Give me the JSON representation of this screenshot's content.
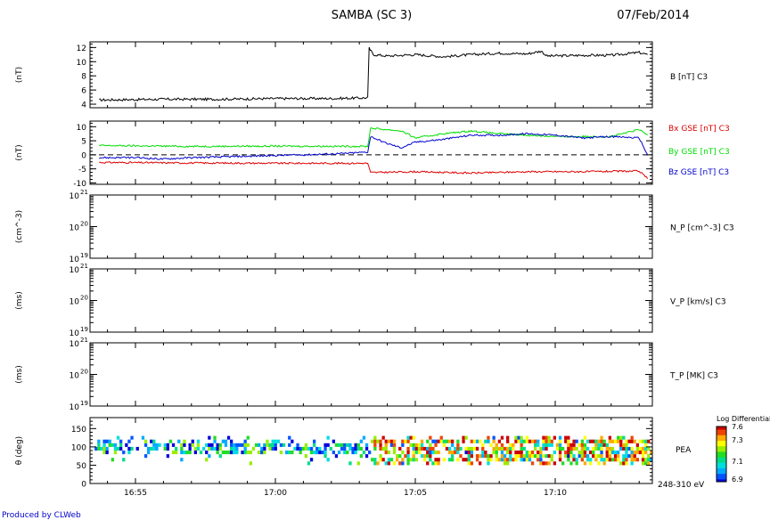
{
  "header": {
    "title": "SAMBA (SC 3)",
    "date": "07/Feb/2014"
  },
  "footer": {
    "credit": "Produced by CLWeb"
  },
  "colors": {
    "black": "#000000",
    "red": "#dd0000",
    "green": "#00dd00",
    "blue": "#0000cc"
  },
  "time_ticks": [
    "16:55",
    "17:00",
    "17:05",
    "17:10"
  ],
  "chart_data": [
    {
      "type": "line",
      "ylabel": "(nT)",
      "ylim": [
        3.5,
        12.8
      ],
      "yticks": [
        4,
        6,
        8,
        10,
        12
      ],
      "xlim_min": [
        -6.4,
        13.3
      ],
      "series": [
        {
          "name": "B [nT] C3",
          "color": "#000000",
          "points": [
            [
              -6.3,
              4.6
            ],
            [
              -4,
              4.7
            ],
            [
              -2,
              4.7
            ],
            [
              0,
              4.8
            ],
            [
              2,
              4.8
            ],
            [
              3.3,
              4.9
            ],
            [
              3.35,
              11.9
            ],
            [
              3.5,
              11.0
            ],
            [
              4,
              10.8
            ],
            [
              5,
              11.0
            ],
            [
              6,
              10.7
            ],
            [
              7,
              11.0
            ],
            [
              8,
              11.2
            ],
            [
              9,
              11.1
            ],
            [
              9.5,
              11.5
            ],
            [
              9.7,
              10.8
            ],
            [
              11,
              10.9
            ],
            [
              12,
              10.9
            ],
            [
              13,
              11.3
            ],
            [
              13.3,
              11.0
            ]
          ]
        }
      ]
    },
    {
      "type": "line",
      "ylabel": "(nT)",
      "ylim": [
        -10.5,
        12
      ],
      "yticks": [
        -10,
        -5,
        0,
        5,
        10
      ],
      "zero_line": true,
      "xlim_min": [
        -6.4,
        13.3
      ],
      "series": [
        {
          "name": "Bx GSE [nT] C3",
          "color": "#dd0000",
          "points": [
            [
              -6.3,
              -2.7
            ],
            [
              -3,
              -2.9
            ],
            [
              0,
              -3.0
            ],
            [
              3.3,
              -3.0
            ],
            [
              3.4,
              -6.3
            ],
            [
              5,
              -6.0
            ],
            [
              7,
              -6.5
            ],
            [
              9,
              -6.0
            ],
            [
              11,
              -6.0
            ],
            [
              13,
              -5.8
            ],
            [
              13.3,
              -8.5
            ]
          ]
        },
        {
          "name": "By GSE [nT] C3",
          "color": "#00dd00",
          "points": [
            [
              -6.3,
              3.3
            ],
            [
              -3,
              3.0
            ],
            [
              0,
              3.1
            ],
            [
              3.3,
              3.0
            ],
            [
              3.4,
              9.5
            ],
            [
              4.5,
              8.5
            ],
            [
              5,
              6.0
            ],
            [
              6,
              7.5
            ],
            [
              7,
              8.5
            ],
            [
              8,
              7.5
            ],
            [
              9,
              7.0
            ],
            [
              10,
              6.5
            ],
            [
              12,
              6.5
            ],
            [
              13,
              9.0
            ],
            [
              13.3,
              7.0
            ]
          ]
        },
        {
          "name": "Bz GSE [nT] C3",
          "color": "#0000cc",
          "points": [
            [
              -6.3,
              -1.0
            ],
            [
              -5,
              -1.0
            ],
            [
              -4,
              -1.5
            ],
            [
              -3,
              -1.0
            ],
            [
              -1,
              -0.5
            ],
            [
              1,
              0.0
            ],
            [
              2.5,
              0.5
            ],
            [
              3.3,
              1.0
            ],
            [
              3.4,
              6.5
            ],
            [
              4,
              4.0
            ],
            [
              4.5,
              2.5
            ],
            [
              5,
              4.5
            ],
            [
              6,
              5.5
            ],
            [
              7,
              7.0
            ],
            [
              8,
              7.0
            ],
            [
              9,
              7.5
            ],
            [
              10,
              7.0
            ],
            [
              11,
              6.0
            ],
            [
              12,
              6.5
            ],
            [
              13,
              6.0
            ],
            [
              13.3,
              0.0
            ]
          ]
        }
      ]
    },
    {
      "type": "line",
      "ylabel": "(cm^-3)",
      "log": true,
      "yticks": [
        {
          "b": "10",
          "e": "21"
        },
        {
          "b": "10",
          "e": "20"
        },
        {
          "b": "10",
          "e": "19"
        }
      ],
      "series": [
        {
          "name": "N_P [cm^-3] C3",
          "values": []
        }
      ]
    },
    {
      "type": "line",
      "ylabel": "(ms)",
      "log": true,
      "yticks": [
        {
          "b": "10",
          "e": "21"
        },
        {
          "b": "10",
          "e": "20"
        },
        {
          "b": "10",
          "e": "19"
        }
      ],
      "series": [
        {
          "name": "V_P [km/s] C3",
          "values": []
        }
      ]
    },
    {
      "type": "line",
      "ylabel": "(ms)",
      "log": true,
      "yticks": [
        {
          "b": "10",
          "e": "21"
        },
        {
          "b": "10",
          "e": "20"
        },
        {
          "b": "10",
          "e": "19"
        }
      ],
      "series": [
        {
          "name": "T_P [MK] C3",
          "values": []
        }
      ]
    },
    {
      "type": "heatmap",
      "ylabel": "θ (deg)",
      "ylim": [
        0,
        180
      ],
      "yticks": [
        0,
        50,
        100,
        150
      ],
      "label": "PEA",
      "energy": "248-310 eV",
      "colorbar": {
        "title": "Log Differential",
        "range": [
          6.9,
          7.6
        ],
        "ticks": [
          "7.6",
          "7.3",
          "7.1",
          "6.9"
        ]
      },
      "bins_deg": [
        [
          50,
          60
        ],
        [
          60,
          70
        ],
        [
          70,
          80
        ],
        [
          80,
          90
        ],
        [
          90,
          100
        ],
        [
          100,
          110
        ],
        [
          110,
          120
        ],
        [
          120,
          130
        ]
      ]
    }
  ]
}
